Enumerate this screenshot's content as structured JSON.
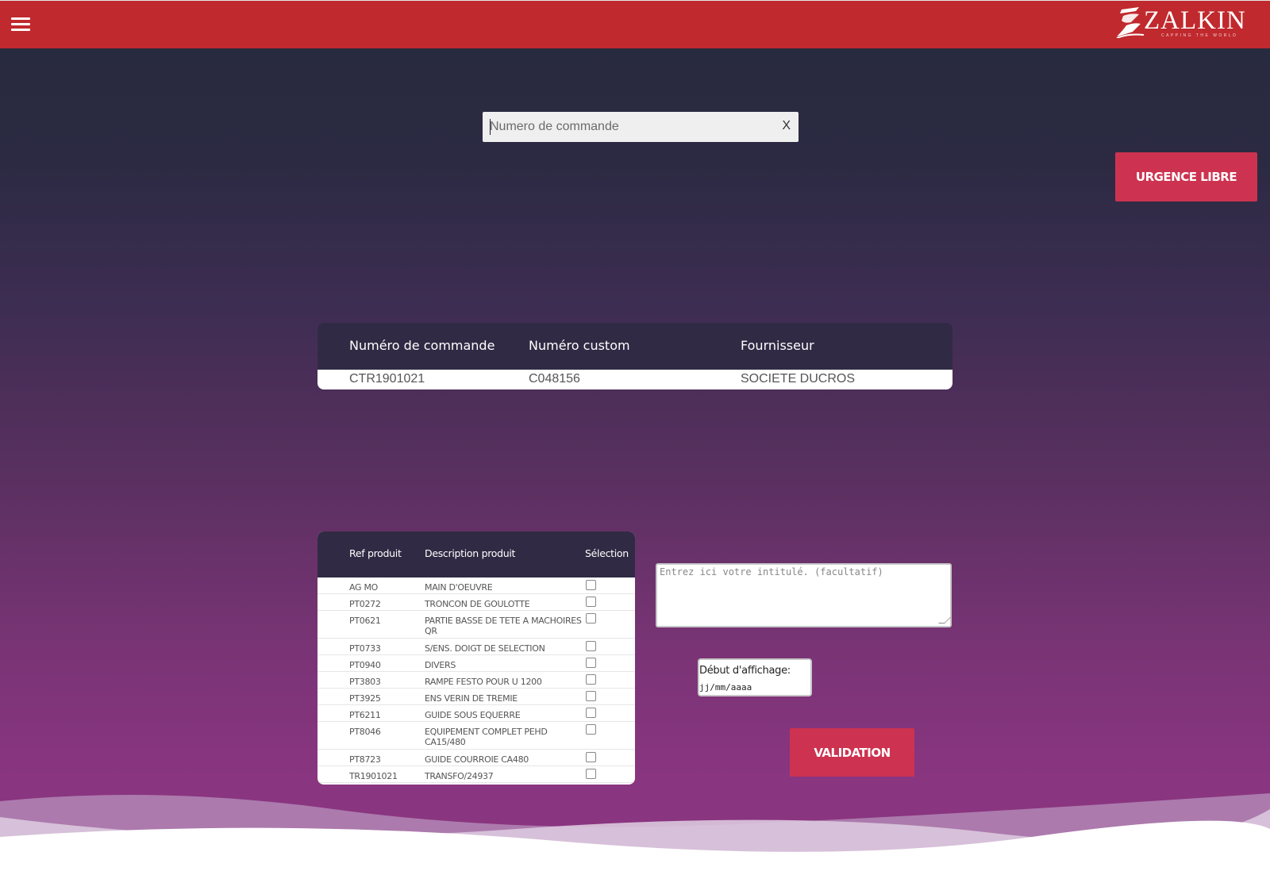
{
  "header": {
    "menu_icon": "hamburger-icon",
    "logo_text": "ZALKIN",
    "logo_tagline": "CAPPING THE WORLD",
    "brand_color": "#c0292d"
  },
  "search": {
    "placeholder": "Numero de commande",
    "value": "",
    "clear_label": "X"
  },
  "urgence_button": {
    "label": "URGENCE LIBRE"
  },
  "order_table": {
    "headers": [
      "Numéro de commande",
      "Numéro custom",
      "Fournisseur"
    ],
    "row": [
      "CTR1901021",
      "C048156",
      "SOCIETE DUCROS"
    ]
  },
  "product_table": {
    "headers": [
      "Ref produit",
      "Description produit",
      "Sélection"
    ],
    "rows": [
      {
        "ref": "AG MO",
        "desc": "MAIN D'OEUVRE",
        "selected": false
      },
      {
        "ref": "PT0272",
        "desc": "TRONCON DE GOULOTTE",
        "selected": false
      },
      {
        "ref": "PT0621",
        "desc": "PARTIE BASSE DE TETE A MACHOIRES QR",
        "selected": false
      },
      {
        "ref": "PT0733",
        "desc": "S/ENS. DOIGT DE SELECTION",
        "selected": false
      },
      {
        "ref": "PT0940",
        "desc": "DIVERS",
        "selected": false
      },
      {
        "ref": "PT3803",
        "desc": "RAMPE FESTO POUR U 1200",
        "selected": false
      },
      {
        "ref": "PT3925",
        "desc": "ENS VERIN DE TREMIE",
        "selected": false
      },
      {
        "ref": "PT6211",
        "desc": "GUIDE SOUS EQUERRE",
        "selected": false
      },
      {
        "ref": "PT8046",
        "desc": "EQUIPEMENT COMPLET PEHD CA15/480",
        "selected": false
      },
      {
        "ref": "PT8723",
        "desc": "GUIDE COURROIE CA480",
        "selected": false
      },
      {
        "ref": "TR1901021",
        "desc": "TRANSFO/24937",
        "selected": false
      }
    ]
  },
  "note": {
    "placeholder": "Entrez ici votre intitulé. (facultatif)",
    "value": ""
  },
  "date": {
    "label": "Début d'affichage:",
    "placeholder": "jj/mm/aaaa"
  },
  "validation_button": {
    "label": "VALIDATION"
  },
  "colors": {
    "button": "#cd3350",
    "table_header": "#312a44"
  }
}
